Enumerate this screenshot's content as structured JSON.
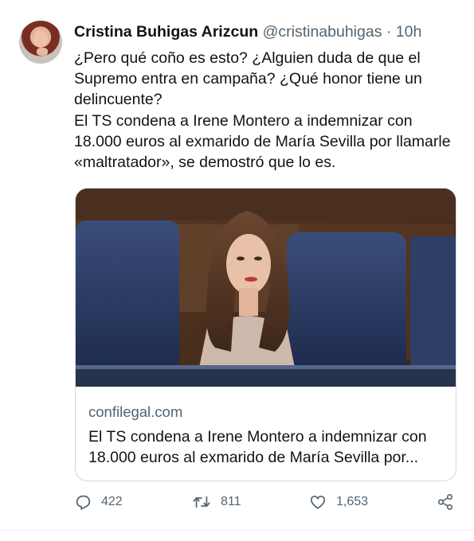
{
  "tweet": {
    "author_name": "Cristina Buhigas Arizcun",
    "author_handle": "@cristinabuhigas",
    "separator": "·",
    "time": "10h",
    "text_lines": [
      "¿Pero qué coño es esto? ¿Alguien duda de que el Supremo entra en campaña? ¿Qué honor tiene un delincuente?",
      "El TS condena a Irene Montero a indemnizar con 18.000 euros al exmarido de María Sevilla por llamarle «maltratador», se demostró que lo es."
    ]
  },
  "card": {
    "domain": "confilegal.com",
    "headline": "El TS condena a Irene Montero a indemnizar con 18.000 euros al exmarido de María Sevilla por..."
  },
  "actions": {
    "replies": "422",
    "retweets": "811",
    "likes": "1,653"
  },
  "icons": [
    "reply-icon",
    "retweet-icon",
    "like-icon",
    "share-icon"
  ],
  "colors": {
    "text": "#0f1419",
    "secondary": "#536471",
    "border": "#cfd9de"
  }
}
